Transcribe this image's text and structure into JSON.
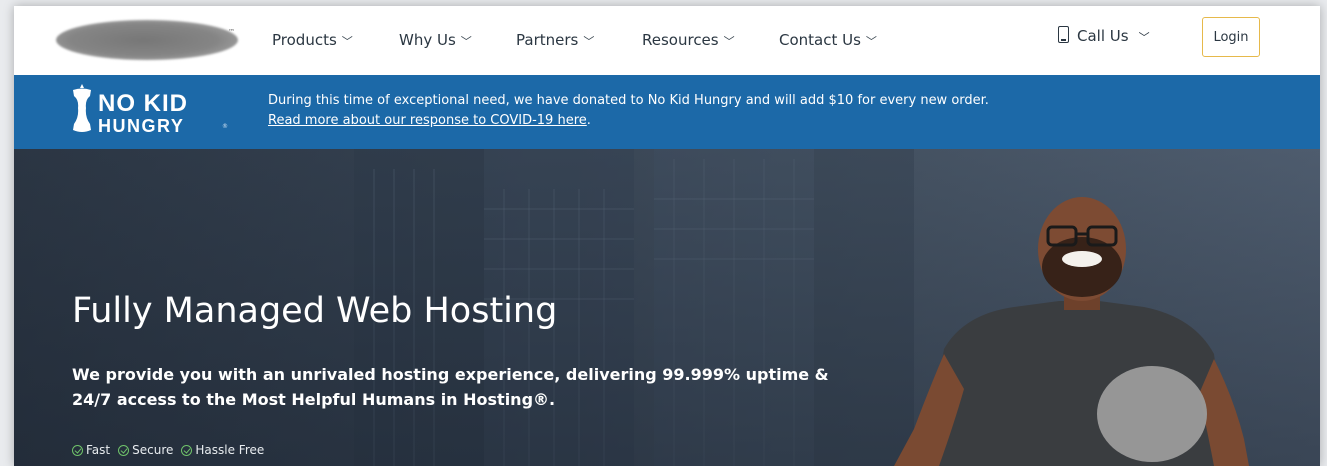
{
  "header": {
    "logo_mark": "™",
    "nav": [
      {
        "label": "Products"
      },
      {
        "label": "Why Us"
      },
      {
        "label": "Partners"
      },
      {
        "label": "Resources"
      },
      {
        "label": "Contact Us"
      }
    ],
    "call_label": "Call Us",
    "login_label": "Login",
    "chevron": "⌵"
  },
  "banner": {
    "logo_line1": "NO KID",
    "logo_line2": "HUNGRY",
    "logo_reg": "®",
    "message": "During this time of exceptional need, we have donated to No Kid Hungry and will add $10 for every new order.",
    "link_text": "Read more about our response to COVID-19 here",
    "link_suffix": ".",
    "bg_color": "#1c69a8"
  },
  "hero": {
    "title": "Fully Managed Web Hosting",
    "subtitle_line1": "We provide you with an unrivaled hosting experience, delivering 99.999% uptime &",
    "subtitle_line2": "24/7 access to the Most Helpful Humans in Hosting®.",
    "features": [
      "Fast",
      "Secure",
      "Hassle Free"
    ],
    "accent_check": "#6fc26a"
  },
  "colors": {
    "login_border": "#e6b94b",
    "nav_text": "#2b3742"
  }
}
